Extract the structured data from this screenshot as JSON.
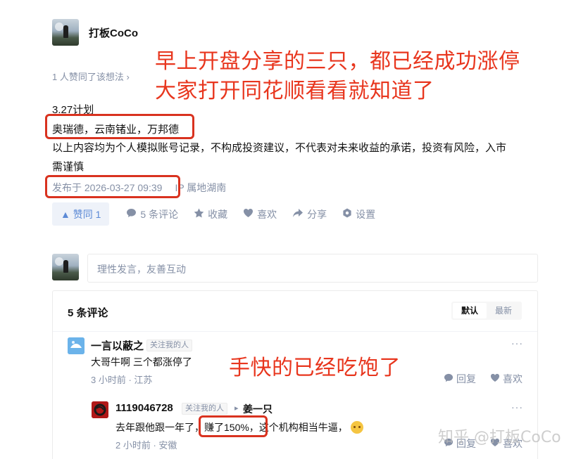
{
  "author": {
    "name": "打板CoCo"
  },
  "overlay": {
    "line1": "早上开盘分享的三只，都已经成功涨停",
    "line2": "大家打开同花顺看看就知道了",
    "comment_note": "手快的已经吃饱了"
  },
  "post": {
    "likers_text": "1 人赞同了该想法",
    "likers_chevron": "›",
    "line_plan": "3.27计划",
    "line_stocks": "奥瑞德，云南锗业，万邦德",
    "line_disclaimer1": "以上内容均为个人模拟账号记录，不构成投资建议，不代表对未来收益的承诺，投资有风险，入市",
    "line_disclaimer2": "需谨慎",
    "published": "发布于 2026-03-27 09:39",
    "ip": "IP 属地湖南"
  },
  "actions": {
    "vote_label": "▲ 赞同 1",
    "comments_label": "5 条评论",
    "collect_label": "收藏",
    "like_label": "喜欢",
    "share_label": "分享",
    "settings_label": "设置"
  },
  "comment_box": {
    "placeholder": "理性发言，友善互动"
  },
  "comments": {
    "count_label": "5 条评论",
    "sort_default": "默认",
    "sort_latest": "最新",
    "items": [
      {
        "name": "一言以蔽之",
        "badge": "关注我的人",
        "text": "大哥牛啊 三个都涨停了",
        "time": "3 小时前 · 江苏",
        "reply": "回复",
        "like": "喜欢",
        "more": "···"
      },
      {
        "name": "1119046728",
        "badge": "关注我的人",
        "reply_arrow": "▸",
        "reply_to": "姜一只",
        "text_before": "去年跟他跟一年了，",
        "text_highlight": "赚了150%，",
        "text_after": "这个机构相当牛逼，",
        "time": "2 小时前 · 安徽",
        "reply": "回复",
        "like": "喜欢",
        "more": "···"
      }
    ]
  },
  "watermark": "知乎 @打板CoCo",
  "colors": {
    "accent_red": "#e8361e",
    "zhihu_blue": "#5c8ad6",
    "muted": "#8590a6"
  }
}
